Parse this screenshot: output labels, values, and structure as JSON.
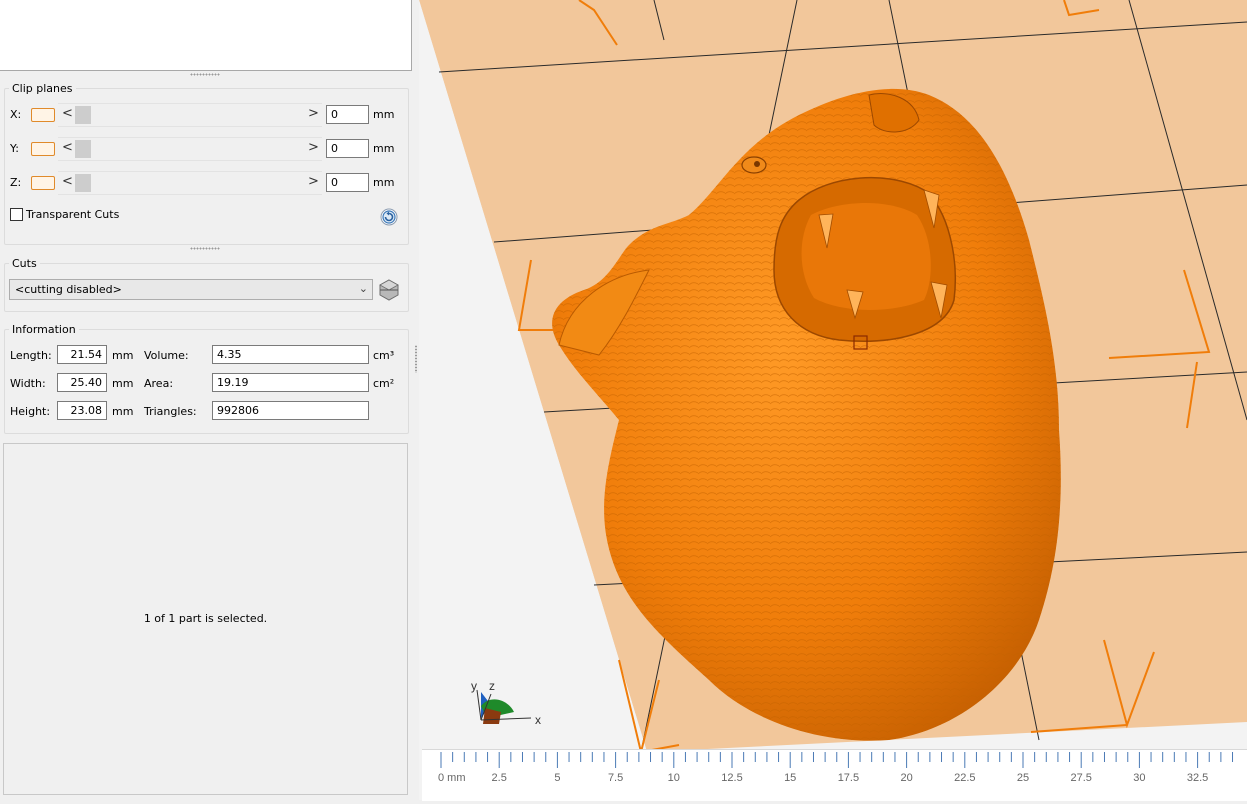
{
  "clip_planes": {
    "title": "Clip planes",
    "axes": [
      {
        "label": "X:",
        "value": "0",
        "unit": "mm"
      },
      {
        "label": "Y:",
        "value": "0",
        "unit": "mm"
      },
      {
        "label": "Z:",
        "value": "0",
        "unit": "mm"
      }
    ],
    "arrow_left": "<",
    "arrow_right": ">",
    "transparent_cuts_label": "Transparent Cuts",
    "transparent_cuts_checked": false,
    "reset_icon": "reset-icon"
  },
  "cuts": {
    "title": "Cuts",
    "selected": "<cutting disabled>",
    "cut_icon": "cut-tool-icon"
  },
  "information": {
    "title": "Information",
    "length_label": "Length:",
    "length_value": "21.54",
    "length_unit": "mm",
    "width_label": "Width:",
    "width_value": "25.40",
    "width_unit": "mm",
    "height_label": "Height:",
    "height_value": "23.08",
    "height_unit": "mm",
    "volume_label": "Volume:",
    "volume_value": "4.35",
    "volume_unit": "cm³",
    "area_label": "Area:",
    "area_value": "19.19",
    "area_unit": "cm²",
    "triangles_label": "Triangles:",
    "triangles_value": "992806"
  },
  "status_text": "1 of 1 part is selected.",
  "viewport": {
    "model_color": "#f07d0a",
    "plate_color": "#f2c79b",
    "axis_x_label": "x",
    "axis_y_label": "y",
    "axis_z_label": "z"
  },
  "ruler": {
    "ticks": [
      "0 mm",
      "2.5",
      "5",
      "7.5",
      "10",
      "12.5",
      "15",
      "17.5",
      "20",
      "22.5",
      "25",
      "27.5",
      "30",
      "32.5"
    ]
  }
}
